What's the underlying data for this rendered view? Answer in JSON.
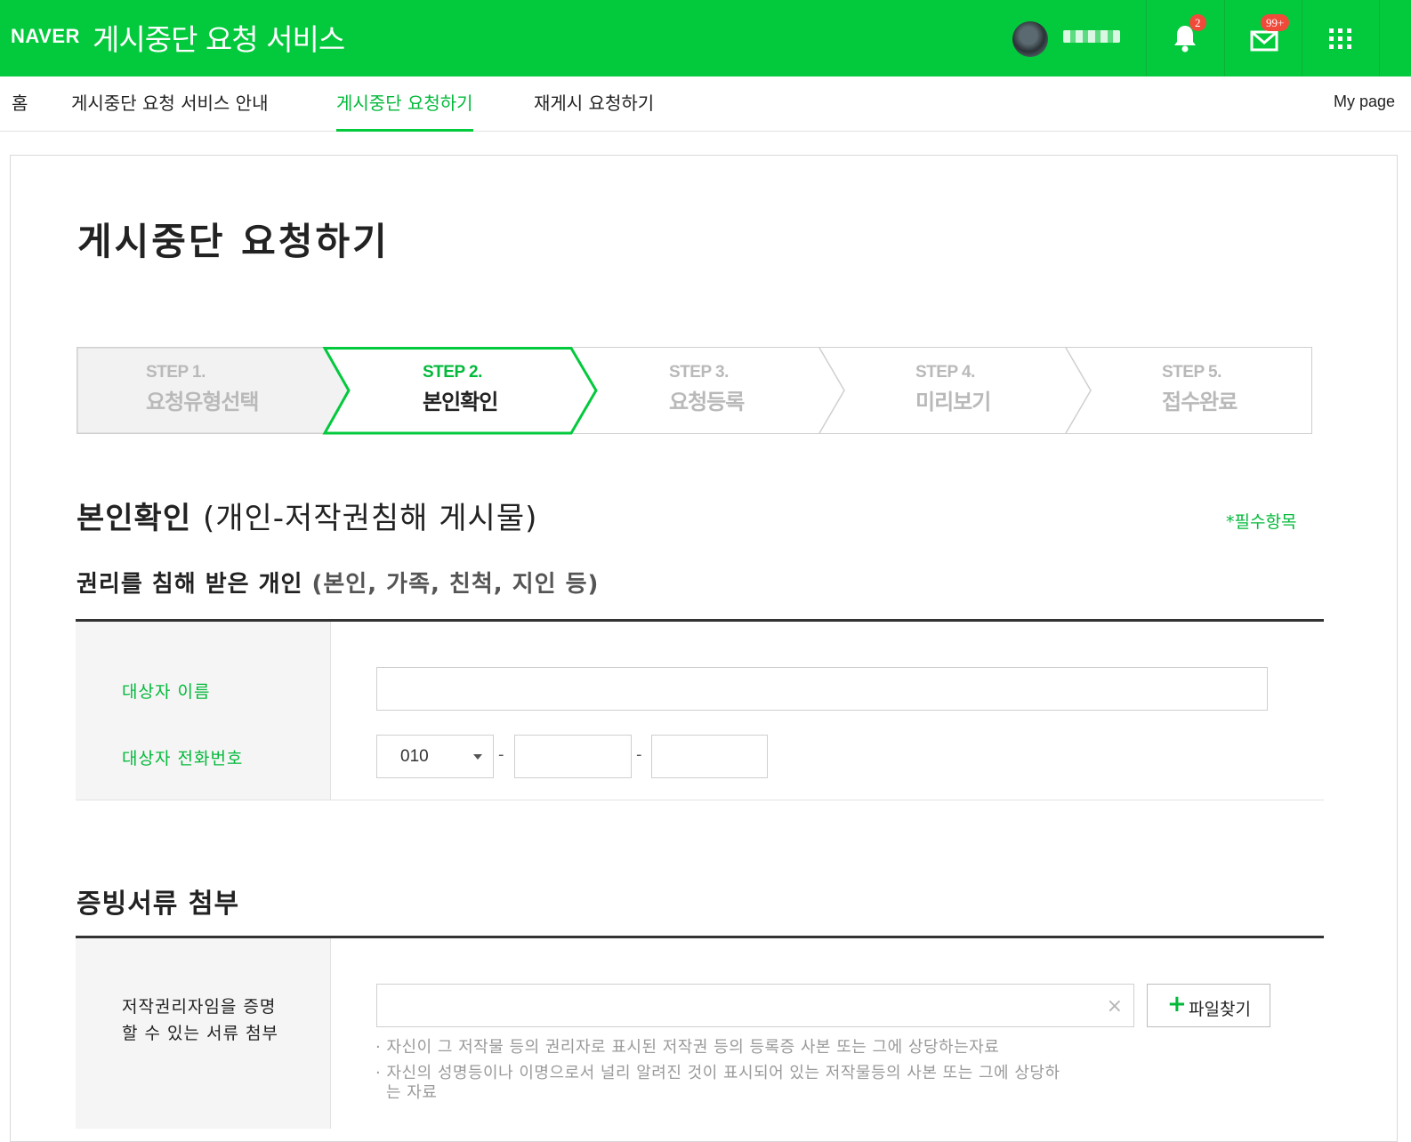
{
  "header": {
    "logo": "NAVER",
    "service_title": "게시중단 요청 서비스",
    "notification_count": "2",
    "mail_count": "99+",
    "brand_color": "#03c93c"
  },
  "nav": {
    "items": [
      {
        "label": "홈"
      },
      {
        "label": "게시중단 요청 서비스 안내"
      },
      {
        "label": "게시중단 요청하기"
      },
      {
        "label": "재게시 요청하기"
      }
    ],
    "active_index": 2,
    "mypage": "My page"
  },
  "page": {
    "title": "게시중단 요청하기"
  },
  "steps": [
    {
      "num": "STEP 1.",
      "name": "요청유형선택",
      "state": "done"
    },
    {
      "num": "STEP 2.",
      "name": "본인확인",
      "state": "current"
    },
    {
      "num": "STEP 3.",
      "name": "요청등록",
      "state": "pending"
    },
    {
      "num": "STEP 4.",
      "name": "미리보기",
      "state": "pending"
    },
    {
      "num": "STEP 5.",
      "name": "접수완료",
      "state": "pending"
    }
  ],
  "identity": {
    "title": "본인확인",
    "title_sub": "(개인-저작권침해 게시물)",
    "required_note": "*필수항목",
    "subtitle": "권리를 침해 받은 개인",
    "subtitle_sub": "(본인, 가족, 친척, 지인 등)",
    "name_label": "대상자 이름",
    "name_value": "",
    "phone_label": "대상자 전화번호",
    "phone_prefix": "010",
    "phone_mid": "",
    "phone_last": "",
    "dash": "-"
  },
  "documents": {
    "title": "증빙서류 첨부",
    "label_line1": "저작권리자임을 증명",
    "label_line2": "할 수 있는 서류 첨부",
    "file_value": "",
    "clear_symbol": "×",
    "button_plus": "+",
    "button_label": "파일찾기",
    "note1": "· 자신이 그 저작물 등의 권리자로 표시된 저작권 등의 등록증 사본 또는 그에 상당하는자료",
    "note2": "· 자신의 성명등이나 이명으로서 널리 알려진 것이 표시되어 있는 저작물등의 사본 또는 그에 상당하",
    "note2_cont": "는 자료"
  }
}
